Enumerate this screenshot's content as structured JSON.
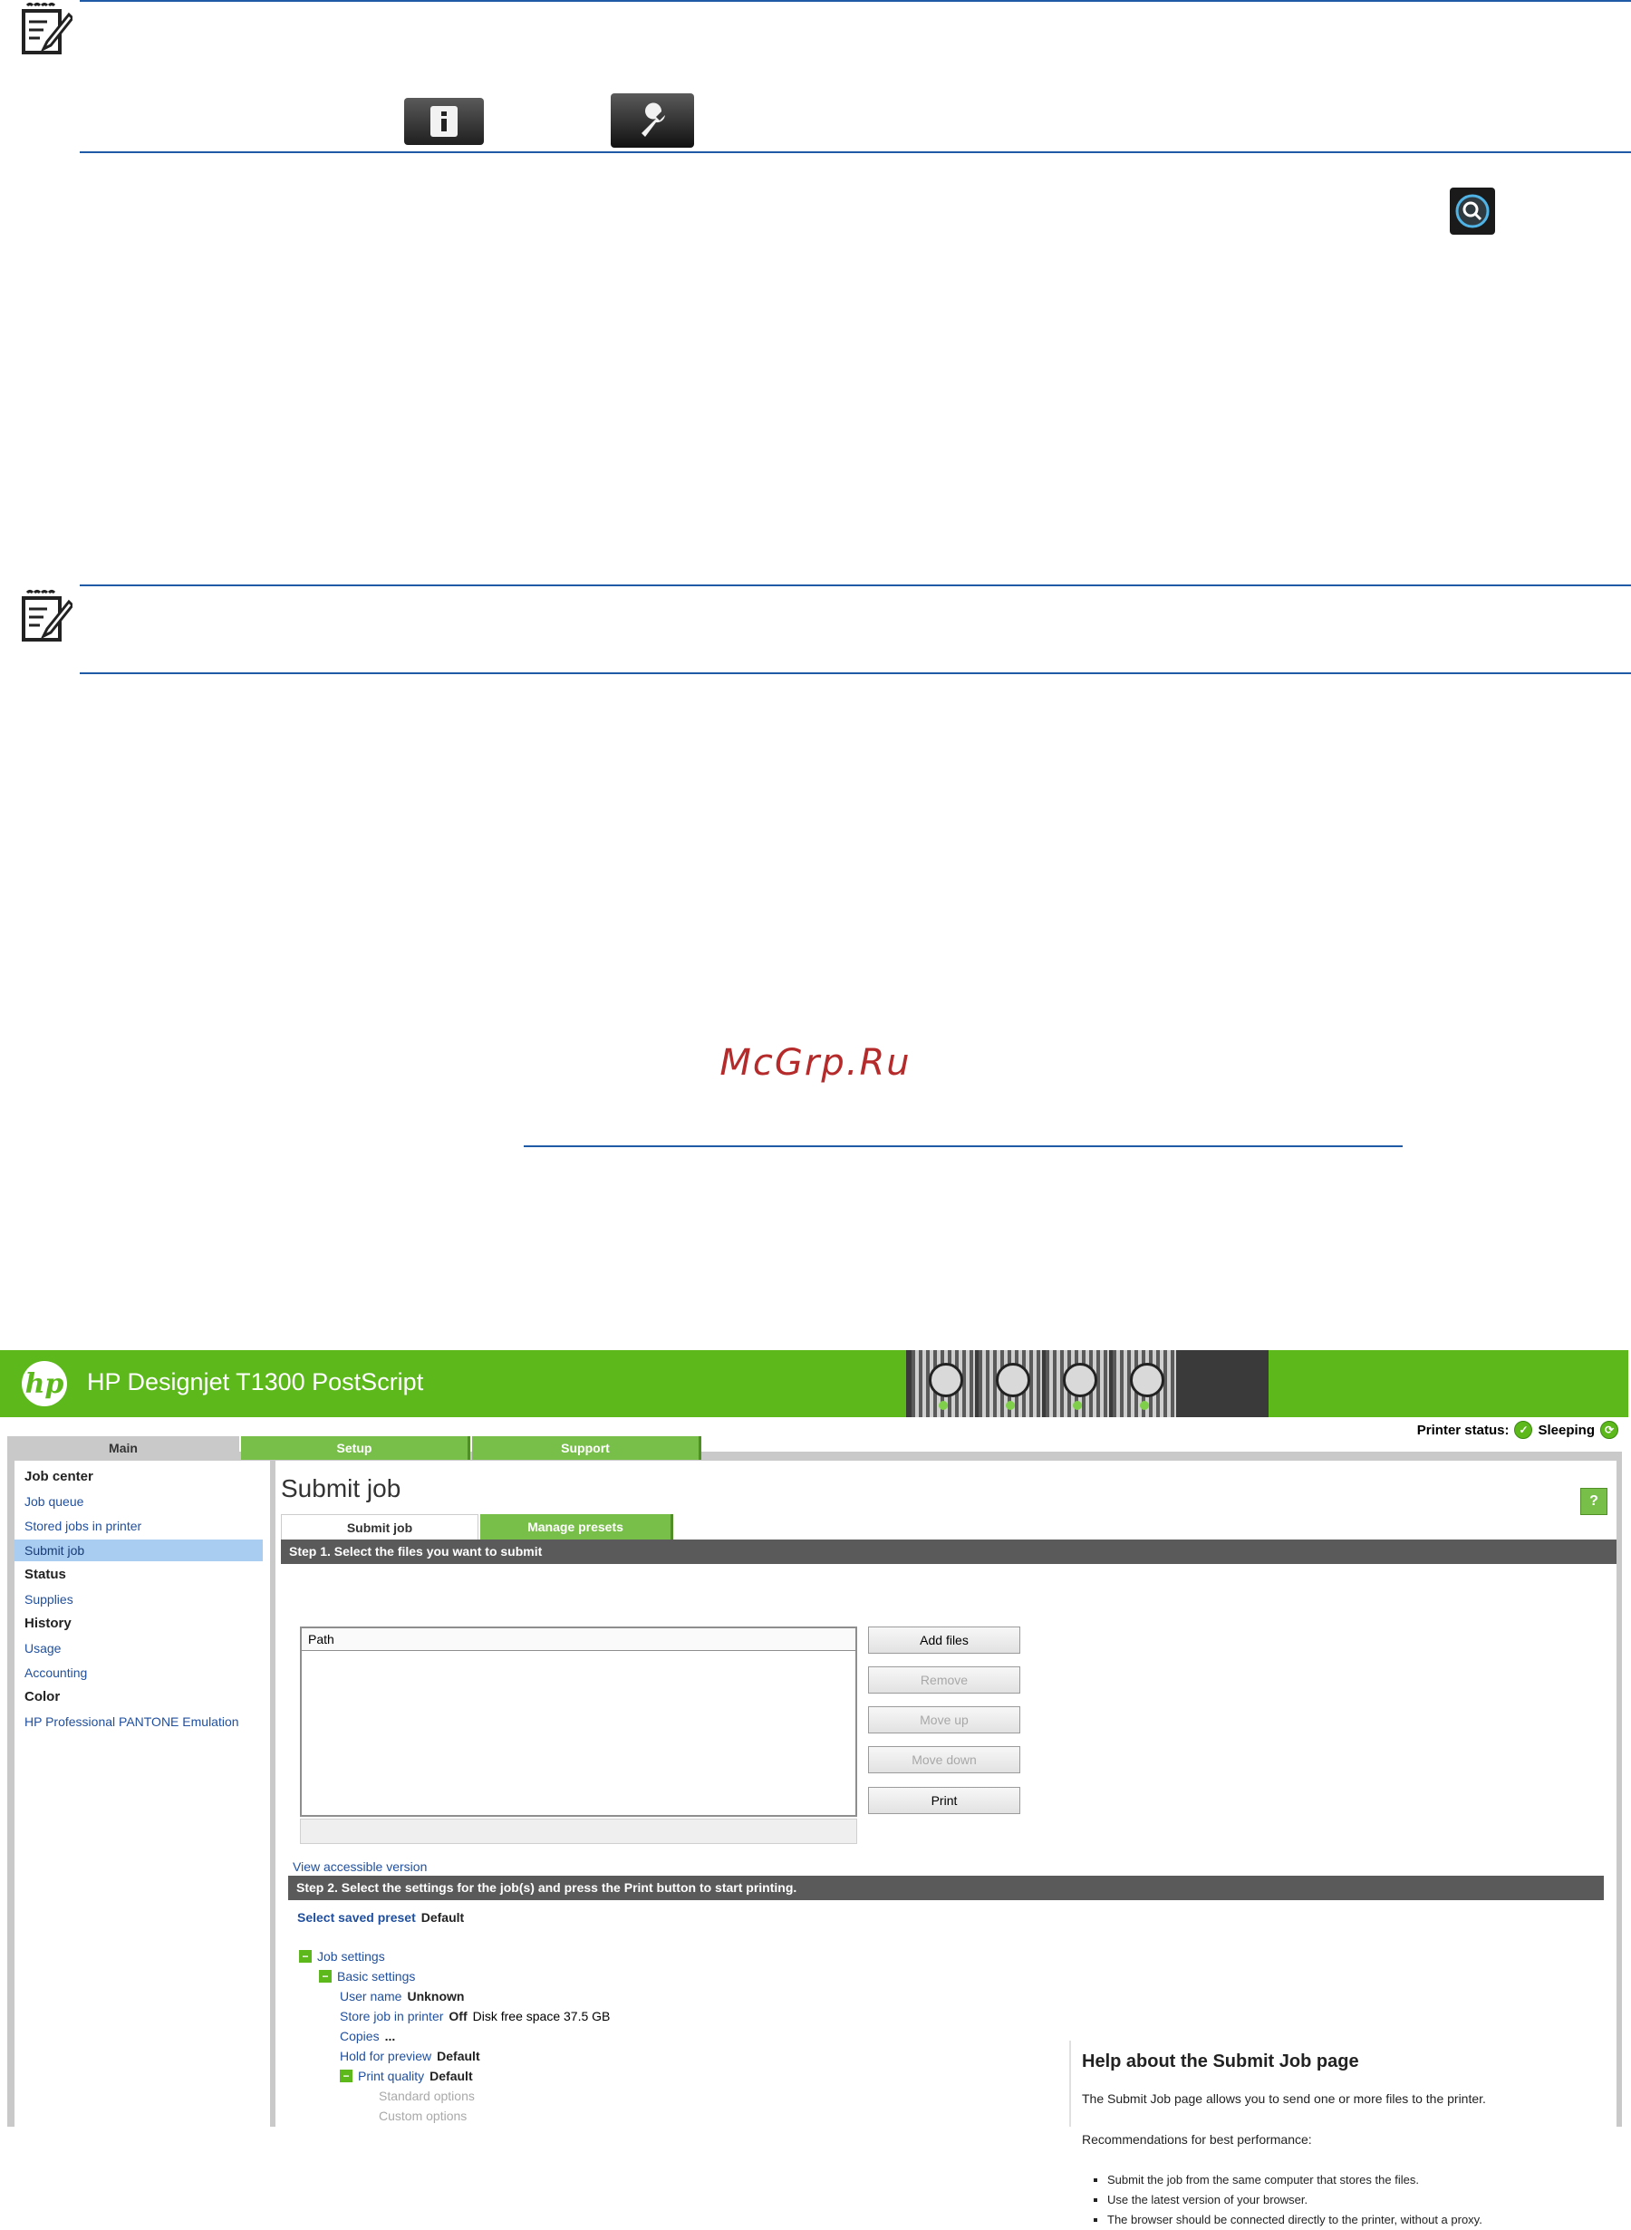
{
  "document": {
    "watermark": "McGrp.Ru"
  },
  "web_ui": {
    "app_title": "HP Designjet T1300 PostScript",
    "printer_status_label": "Printer status:",
    "printer_status_value": "Sleeping",
    "top_tabs": [
      "Main",
      "Setup",
      "Support"
    ],
    "sidebar": {
      "items": [
        {
          "label": "Job center",
          "kind": "heading"
        },
        {
          "label": "Job queue",
          "kind": "link"
        },
        {
          "label": "Stored jobs in printer",
          "kind": "link"
        },
        {
          "label": "Submit job",
          "kind": "selected"
        },
        {
          "label": "Status",
          "kind": "heading"
        },
        {
          "label": "Supplies",
          "kind": "link"
        },
        {
          "label": "History",
          "kind": "heading"
        },
        {
          "label": "Usage",
          "kind": "link"
        },
        {
          "label": "Accounting",
          "kind": "link"
        },
        {
          "label": "Color",
          "kind": "heading"
        },
        {
          "label": "HP Professional PANTONE Emulation",
          "kind": "link"
        }
      ]
    },
    "page_title": "Submit job",
    "help_button": "?",
    "sub_tabs": [
      "Submit job",
      "Manage presets"
    ],
    "step1": "Step 1. Select the files you want to submit",
    "path_header": "Path",
    "buttons": {
      "add_files": "Add files",
      "remove": "Remove",
      "move_up": "Move up",
      "move_down": "Move down",
      "print": "Print"
    },
    "accessible_link": "View accessible version",
    "step2": "Step 2. Select the settings for the job(s) and press the Print button to start printing.",
    "preset": {
      "label": "Select saved preset",
      "value": "Default"
    },
    "tree": {
      "job_settings": "Job settings",
      "basic_settings": "Basic settings",
      "user_name": {
        "label": "User name",
        "value": "Unknown"
      },
      "store_job": {
        "label": "Store job in printer",
        "value": "Off",
        "extra": "Disk free space 37.5 GB"
      },
      "copies": {
        "label": "Copies",
        "value": "..."
      },
      "hold_preview": {
        "label": "Hold for preview",
        "value": "Default"
      },
      "print_quality": {
        "label": "Print quality",
        "value": "Default"
      },
      "standard_options": "Standard options",
      "custom_options": "Custom options"
    },
    "help": {
      "title": "Help about the Submit Job page",
      "p1": "The Submit Job page allows you to send one or more files to the printer.",
      "p2": "Recommendations for best performance:",
      "bullets": [
        "Submit the job from the same computer that stores the files.",
        "Use the latest version of your browser.",
        "The browser should be connected directly to the printer, without a proxy."
      ]
    }
  }
}
